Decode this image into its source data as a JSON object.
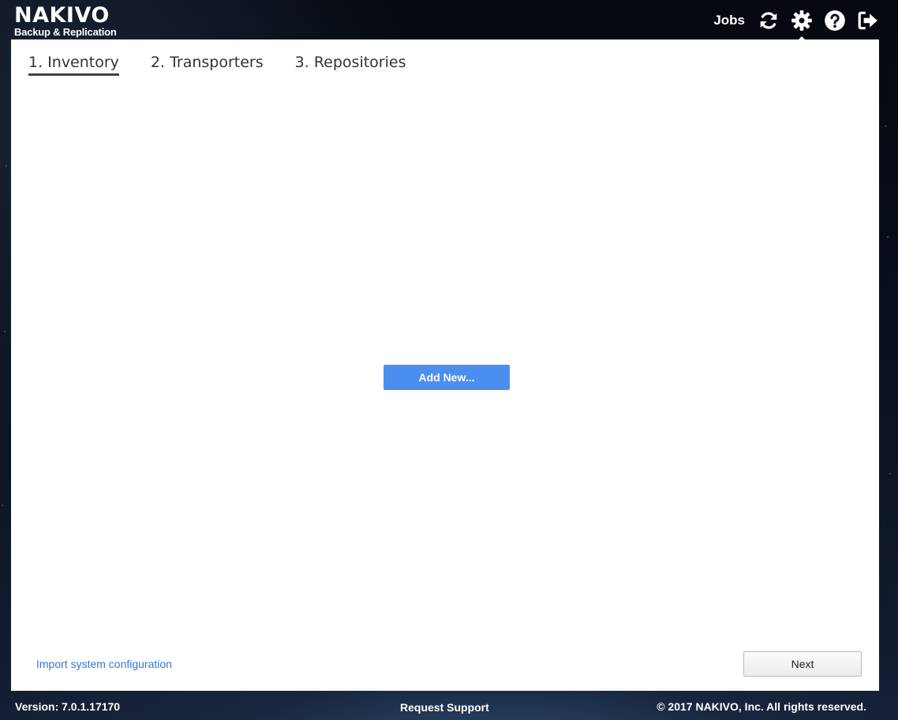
{
  "header": {
    "brand": "NAKIVO",
    "subtitle": "Backup & Replication",
    "jobs_label": "Jobs",
    "icons": [
      "refresh-icon",
      "gear-icon",
      "help-icon",
      "logout-icon"
    ]
  },
  "tabs": [
    {
      "label": "1. Inventory",
      "active": true
    },
    {
      "label": "2. Transporters",
      "active": false
    },
    {
      "label": "3. Repositories",
      "active": false
    }
  ],
  "main": {
    "add_new_label": "Add New..."
  },
  "bottom": {
    "import_label": "Import system configuration",
    "next_label": "Next"
  },
  "footer": {
    "version": "Version: 7.0.1.17170",
    "support": "Request Support",
    "copyright": "© 2017 NAKIVO, Inc. All rights reserved."
  },
  "colors": {
    "accent": "#4a8ff0",
    "link": "#2f7bd9",
    "panel": "#ffffff"
  }
}
